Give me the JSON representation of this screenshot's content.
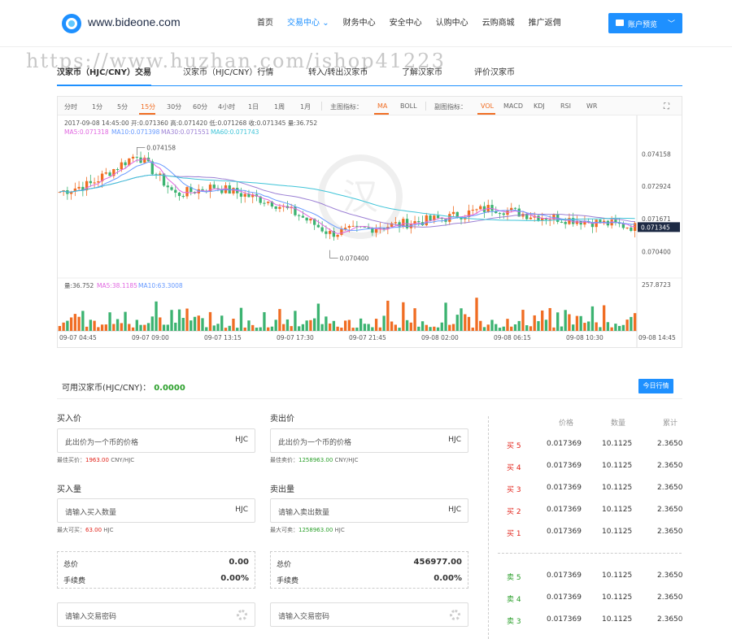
{
  "header": {
    "logo_text": "www.bideone.com",
    "nav": [
      "首页",
      "交易中心",
      "财务中心",
      "安全中心",
      "认购中心",
      "云购商城",
      "推广返佣"
    ],
    "nav_active_index": 1,
    "account_button": "账户预览"
  },
  "watermark": "https://www.huzhan.com/ishop41223",
  "tabs": [
    "汉家币（HJC/CNY）交易",
    "汉家币（HJC/CNY）行情",
    "转入/转出汉家币",
    "了解汉家币",
    "评价汉家币"
  ],
  "toolbar": {
    "periods": [
      "分时",
      "1分",
      "5分",
      "15分",
      "30分",
      "60分",
      "4小时",
      "1日",
      "1周",
      "1月"
    ],
    "active_period": "15分",
    "main_label": "主图指标：",
    "main_indicators": [
      "MA",
      "BOLL"
    ],
    "main_active": "MA",
    "sub_label": "副图指标：",
    "sub_indicators": [
      "VOL",
      "MACD",
      "KDJ",
      "RSI",
      "WR"
    ],
    "sub_active": "VOL"
  },
  "chart_data": {
    "type": "candlestick",
    "info_line": "2017-09-08 14:45:00   开:0.071360  高:0.071420  低:0.071268  收:0.071345  量:36.752",
    "ma_line": {
      "ma5": "MA5:0.071318",
      "ma10": "MA10:0.071398",
      "ma30": "MA30:0.071551",
      "ma60": "MA60:0.071743"
    },
    "vol_line": {
      "vol": "量:36.752",
      "ma5": "MA5:38.1185",
      "ma10": "MA10:63.3008"
    },
    "high_marker": "0.074158",
    "low_marker": "0.070400",
    "price_ticks": [
      "0.074158",
      "0.072924",
      "0.071671",
      "0.070400"
    ],
    "current_price": "0.071345",
    "volume_max": "257.8723",
    "x_labels": [
      "09-07 04:45",
      "09-07 09:00",
      "09-07 13:15",
      "09-07 17:30",
      "09-07 21:45",
      "09-08 02:00",
      "09-08 06:15",
      "09-08 10:30",
      "09-08 14:45"
    ],
    "ylim": [
      0.0697,
      0.0747
    ],
    "colors": {
      "up": "#f06d23",
      "down": "#3cb371",
      "ma5": "#e066e0",
      "ma10": "#6699ff",
      "ma30": "#9b7fd4",
      "ma60": "#3fc4d8"
    }
  },
  "trade": {
    "available_label": "可用汉家币(HJC/CNY)：",
    "available_value": "0.0000",
    "today_button": "今日行情",
    "buy_price_label": "买入价",
    "sell_price_label": "卖出价",
    "price_placeholder": "此出价为一个币的价格",
    "unit": "HJC",
    "best_buy_label": "最佳买价：",
    "best_buy_value": "1963.00",
    "best_sell_label": "最佳卖价：",
    "best_sell_value": "1258963.00",
    "price_unit": "CNY/HJC",
    "buy_qty_label": "买入量",
    "sell_qty_label": "卖出量",
    "buy_qty_placeholder": "请输入买入数量",
    "sell_qty_placeholder": "请输入卖出数量",
    "max_buy_label": "最大可买：",
    "max_buy_value": "63.00",
    "max_sell_label": "最大可卖：",
    "max_sell_value": "1258963.00",
    "max_unit": "HJC",
    "total_label": "总价",
    "fee_label": "手续费",
    "buy_total": "0.00",
    "buy_fee": "0.00%",
    "sell_total": "456977.00",
    "sell_fee": "0.00%",
    "password_placeholder": "请输入交易密码"
  },
  "orderbook": {
    "headers": [
      "价格",
      "数量",
      "累计"
    ],
    "buys": [
      {
        "label": "买 5",
        "price": "0.017369",
        "qty": "10.1125",
        "cum": "2.3650"
      },
      {
        "label": "买 4",
        "price": "0.017369",
        "qty": "10.1125",
        "cum": "2.3650"
      },
      {
        "label": "买 3",
        "price": "0.017369",
        "qty": "10.1125",
        "cum": "2.3650"
      },
      {
        "label": "买 2",
        "price": "0.017369",
        "qty": "10.1125",
        "cum": "2.3650"
      },
      {
        "label": "买 1",
        "price": "0.017369",
        "qty": "10.1125",
        "cum": "2.3650"
      }
    ],
    "sells": [
      {
        "label": "卖 5",
        "price": "0.017369",
        "qty": "10.1125",
        "cum": "2.3650"
      },
      {
        "label": "卖 4",
        "price": "0.017369",
        "qty": "10.1125",
        "cum": "2.3650"
      },
      {
        "label": "卖 3",
        "price": "0.017369",
        "qty": "10.1125",
        "cum": "2.3650"
      }
    ]
  }
}
